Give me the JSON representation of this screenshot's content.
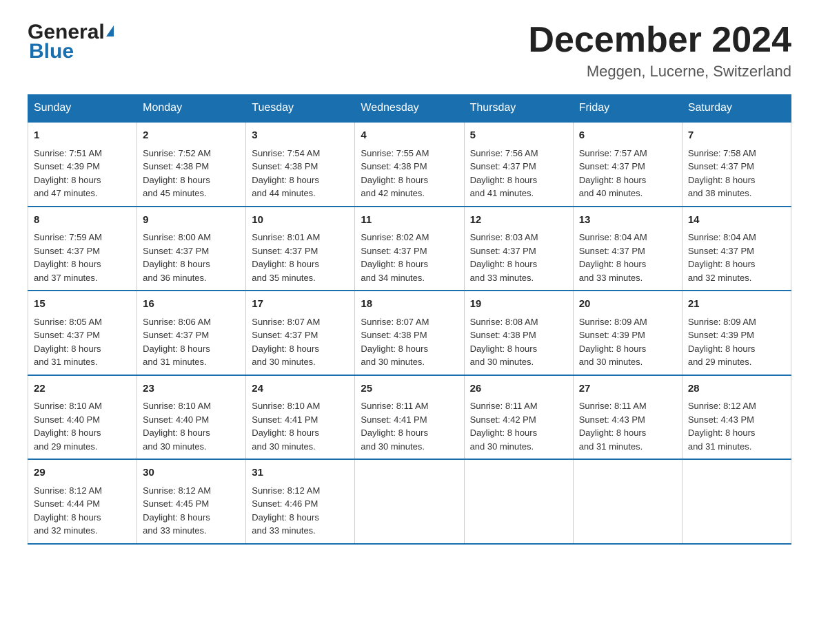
{
  "header": {
    "logo_general": "General",
    "logo_blue": "Blue",
    "month_title": "December 2024",
    "location": "Meggen, Lucerne, Switzerland"
  },
  "days_of_week": [
    "Sunday",
    "Monday",
    "Tuesday",
    "Wednesday",
    "Thursday",
    "Friday",
    "Saturday"
  ],
  "weeks": [
    [
      {
        "day": "1",
        "sunrise": "7:51 AM",
        "sunset": "4:39 PM",
        "daylight": "8 hours and 47 minutes."
      },
      {
        "day": "2",
        "sunrise": "7:52 AM",
        "sunset": "4:38 PM",
        "daylight": "8 hours and 45 minutes."
      },
      {
        "day": "3",
        "sunrise": "7:54 AM",
        "sunset": "4:38 PM",
        "daylight": "8 hours and 44 minutes."
      },
      {
        "day": "4",
        "sunrise": "7:55 AM",
        "sunset": "4:38 PM",
        "daylight": "8 hours and 42 minutes."
      },
      {
        "day": "5",
        "sunrise": "7:56 AM",
        "sunset": "4:37 PM",
        "daylight": "8 hours and 41 minutes."
      },
      {
        "day": "6",
        "sunrise": "7:57 AM",
        "sunset": "4:37 PM",
        "daylight": "8 hours and 40 minutes."
      },
      {
        "day": "7",
        "sunrise": "7:58 AM",
        "sunset": "4:37 PM",
        "daylight": "8 hours and 38 minutes."
      }
    ],
    [
      {
        "day": "8",
        "sunrise": "7:59 AM",
        "sunset": "4:37 PM",
        "daylight": "8 hours and 37 minutes."
      },
      {
        "day": "9",
        "sunrise": "8:00 AM",
        "sunset": "4:37 PM",
        "daylight": "8 hours and 36 minutes."
      },
      {
        "day": "10",
        "sunrise": "8:01 AM",
        "sunset": "4:37 PM",
        "daylight": "8 hours and 35 minutes."
      },
      {
        "day": "11",
        "sunrise": "8:02 AM",
        "sunset": "4:37 PM",
        "daylight": "8 hours and 34 minutes."
      },
      {
        "day": "12",
        "sunrise": "8:03 AM",
        "sunset": "4:37 PM",
        "daylight": "8 hours and 33 minutes."
      },
      {
        "day": "13",
        "sunrise": "8:04 AM",
        "sunset": "4:37 PM",
        "daylight": "8 hours and 33 minutes."
      },
      {
        "day": "14",
        "sunrise": "8:04 AM",
        "sunset": "4:37 PM",
        "daylight": "8 hours and 32 minutes."
      }
    ],
    [
      {
        "day": "15",
        "sunrise": "8:05 AM",
        "sunset": "4:37 PM",
        "daylight": "8 hours and 31 minutes."
      },
      {
        "day": "16",
        "sunrise": "8:06 AM",
        "sunset": "4:37 PM",
        "daylight": "8 hours and 31 minutes."
      },
      {
        "day": "17",
        "sunrise": "8:07 AM",
        "sunset": "4:37 PM",
        "daylight": "8 hours and 30 minutes."
      },
      {
        "day": "18",
        "sunrise": "8:07 AM",
        "sunset": "4:38 PM",
        "daylight": "8 hours and 30 minutes."
      },
      {
        "day": "19",
        "sunrise": "8:08 AM",
        "sunset": "4:38 PM",
        "daylight": "8 hours and 30 minutes."
      },
      {
        "day": "20",
        "sunrise": "8:09 AM",
        "sunset": "4:39 PM",
        "daylight": "8 hours and 30 minutes."
      },
      {
        "day": "21",
        "sunrise": "8:09 AM",
        "sunset": "4:39 PM",
        "daylight": "8 hours and 29 minutes."
      }
    ],
    [
      {
        "day": "22",
        "sunrise": "8:10 AM",
        "sunset": "4:40 PM",
        "daylight": "8 hours and 29 minutes."
      },
      {
        "day": "23",
        "sunrise": "8:10 AM",
        "sunset": "4:40 PM",
        "daylight": "8 hours and 30 minutes."
      },
      {
        "day": "24",
        "sunrise": "8:10 AM",
        "sunset": "4:41 PM",
        "daylight": "8 hours and 30 minutes."
      },
      {
        "day": "25",
        "sunrise": "8:11 AM",
        "sunset": "4:41 PM",
        "daylight": "8 hours and 30 minutes."
      },
      {
        "day": "26",
        "sunrise": "8:11 AM",
        "sunset": "4:42 PM",
        "daylight": "8 hours and 30 minutes."
      },
      {
        "day": "27",
        "sunrise": "8:11 AM",
        "sunset": "4:43 PM",
        "daylight": "8 hours and 31 minutes."
      },
      {
        "day": "28",
        "sunrise": "8:12 AM",
        "sunset": "4:43 PM",
        "daylight": "8 hours and 31 minutes."
      }
    ],
    [
      {
        "day": "29",
        "sunrise": "8:12 AM",
        "sunset": "4:44 PM",
        "daylight": "8 hours and 32 minutes."
      },
      {
        "day": "30",
        "sunrise": "8:12 AM",
        "sunset": "4:45 PM",
        "daylight": "8 hours and 33 minutes."
      },
      {
        "day": "31",
        "sunrise": "8:12 AM",
        "sunset": "4:46 PM",
        "daylight": "8 hours and 33 minutes."
      },
      null,
      null,
      null,
      null
    ]
  ],
  "labels": {
    "sunrise": "Sunrise:",
    "sunset": "Sunset:",
    "daylight": "Daylight:"
  }
}
